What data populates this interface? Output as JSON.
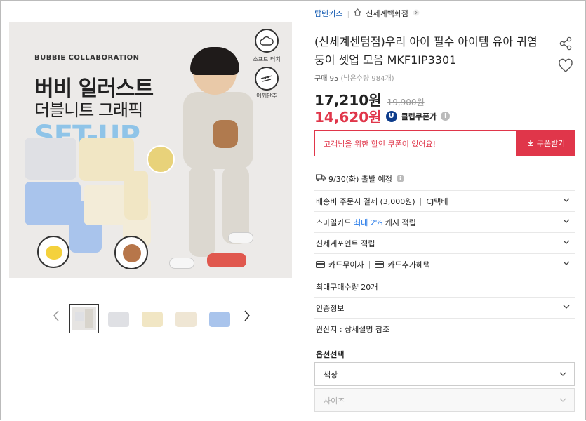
{
  "image": {
    "collab": "BUBBIE COLLABORATION",
    "line1": "버비 일러스트",
    "line2": "더블니트 그래픽",
    "line3": "SET-UP",
    "badge1": "소프트 터치",
    "badge2": "어깨단추"
  },
  "breadcrumb": {
    "category": "탑텐키즈",
    "store": "신세계백화점"
  },
  "product": {
    "title": "(신세계센텀점)우리 아이 필수 아이템 유아 귀염둥이 셋업 모음 MKF1IP3301",
    "sold": "구매 95",
    "remaining": "(남은수량 984개)",
    "price": "17,210원",
    "original_price": "19,900원",
    "coupon_price": "14,620원",
    "coupon_logo": "U",
    "coupon_label": "클립쿠폰가",
    "info_mark": "i"
  },
  "coupon": {
    "message": "고객님을 위한 할인 쿠폰이 있어요!",
    "button": "쿠폰받기"
  },
  "rows": {
    "delivery": "9/30(화) 출발 예정",
    "shipping_fee": "배송비 주문시 결제 (3,000원)",
    "courier_sep": "|",
    "courier": "CJ택배",
    "smile_card_a": "스마일카드",
    "smile_card_b": "최대 2%",
    "smile_card_c": "캐시 적립",
    "point": "신세계포인트 적립",
    "card_interest": "카드무이자",
    "card_sep": "|",
    "card_benefit": "카드추가혜택",
    "max_buy": "최대구매수량 20개",
    "cert": "인증정보",
    "origin": "원산지 : 상세설명 참조"
  },
  "options": {
    "title": "옵션선택",
    "color": "색상",
    "size": "사이즈"
  },
  "colors": {
    "accent": "#e0364a",
    "link": "#1a5fb4",
    "setup_blue": "#8fc4e8"
  }
}
